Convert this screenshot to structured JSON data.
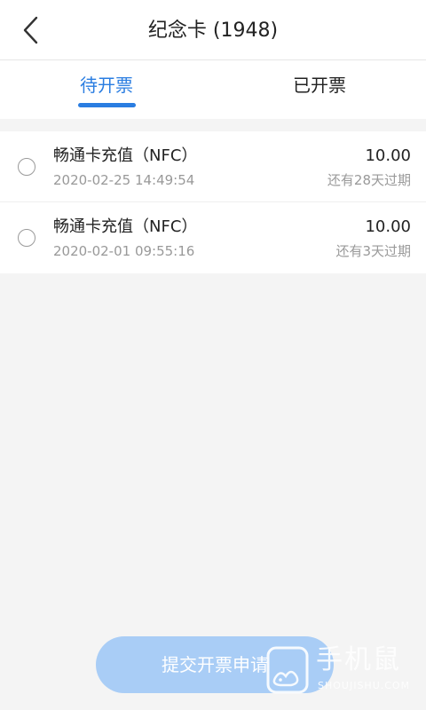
{
  "header": {
    "title": "纪念卡 (1948)",
    "back_icon": "chevron-left-icon"
  },
  "tabs": [
    {
      "label": "待开票",
      "active": true
    },
    {
      "label": "已开票",
      "active": false
    }
  ],
  "colors": {
    "accent": "#2a7de1",
    "button_disabled": "#a9cdf6",
    "background": "#f4f4f4"
  },
  "items": [
    {
      "name": "畅通卡充值（NFC）",
      "time": "2020-02-25 14:49:54",
      "amount": "10.00",
      "expire": "还有28天过期",
      "selected": false
    },
    {
      "name": "畅通卡充值（NFC）",
      "time": "2020-02-01 09:55:16",
      "amount": "10.00",
      "expire": "还有3天过期",
      "selected": false
    }
  ],
  "submit_label": "提交开票申请",
  "watermark": {
    "text": "手机鼠",
    "sub": "SHOUJISHU.COM"
  }
}
